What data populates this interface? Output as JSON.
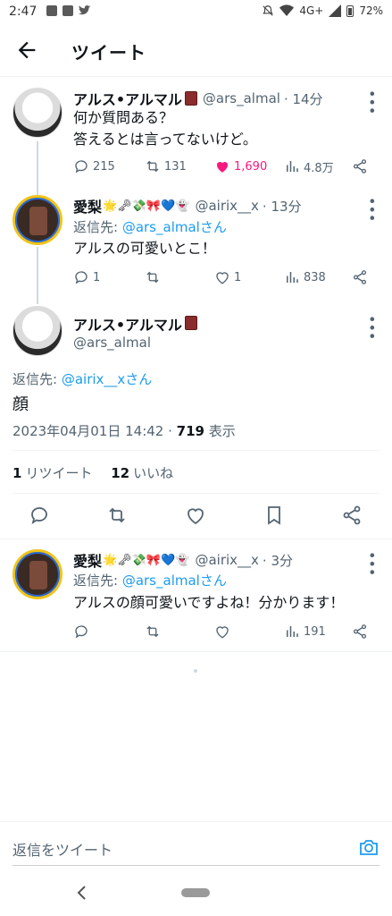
{
  "status": {
    "time": "2:47",
    "network": "4G+",
    "battery": "72%"
  },
  "header": {
    "title": "ツイート"
  },
  "tweets": [
    {
      "name": "アルス•アルマル",
      "handle": "@ars_almal",
      "time": "· 14分",
      "text_lines": [
        "何か質問ある？",
        "答えるとは言ってないけど。"
      ],
      "actions": {
        "reply": "215",
        "retweet": "131",
        "like": "1,690",
        "views": "4.8万"
      }
    },
    {
      "name": "愛梨",
      "name_emojis": "🌟🗝💸🎀💙👻",
      "handle": "@airix__x",
      "time": "· 13分",
      "reply_prefix": "返信先: ",
      "reply_to": "@ars_almalさん",
      "text_lines": [
        "アルスの可愛いとこ！"
      ],
      "actions": {
        "reply": "1",
        "retweet": "",
        "like": "1",
        "views": "838"
      }
    }
  ],
  "main_tweet": {
    "name": "アルス•アルマル",
    "handle": "@ars_almal",
    "reply_prefix": "返信先: ",
    "reply_to": "@airix__xさん",
    "text": "顔",
    "datetime": "2023年04月01日 14:42 · ",
    "views_count": "719",
    "views_label": " 表示",
    "retweets_count": "1",
    "retweets_label": "リツイート",
    "likes_count": "12",
    "likes_label": "いいね"
  },
  "reply_tweet": {
    "name": "愛梨",
    "name_emojis": "🌟🗝💸🎀💙👻",
    "handle": "@airix__x",
    "time": "· 3分",
    "reply_prefix": "返信先: ",
    "reply_to": "@ars_almalさん",
    "text": "アルスの顔可愛いですよね！分かります！",
    "actions": {
      "views": "191"
    }
  },
  "compose": {
    "placeholder": "返信をツイート"
  },
  "colors": {
    "accent": "#1d9bf0",
    "like": "#f91880",
    "muted": "#536471"
  }
}
